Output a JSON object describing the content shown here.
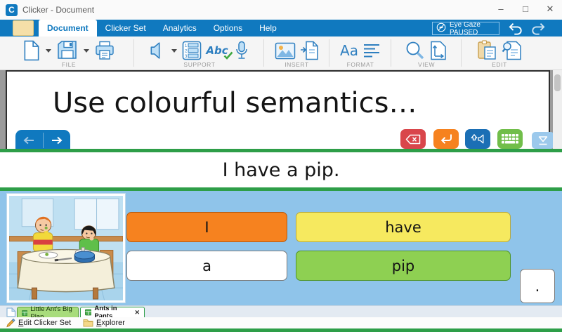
{
  "window": {
    "app_initial": "C",
    "title": "Clicker - Document",
    "controls": {
      "minimize": "–",
      "maximize": "□",
      "close": "✕"
    }
  },
  "colors": {
    "accent_blue": "#1079BF",
    "accent_green": "#2E9E48",
    "grid_background": "#8FC4EA"
  },
  "ribbon": {
    "tabs": [
      {
        "label": "Document",
        "active": true
      },
      {
        "label": "Clicker Set",
        "active": false
      },
      {
        "label": "Analytics",
        "active": false
      },
      {
        "label": "Options",
        "active": false
      },
      {
        "label": "Help",
        "active": false
      }
    ],
    "eye_gaze_label": "Eye Gaze PAUSED",
    "groups": [
      {
        "label": "FILE"
      },
      {
        "label": "SUPPORT"
      },
      {
        "label": "INSERT"
      },
      {
        "label": "FORMAT"
      },
      {
        "label": "VIEW"
      },
      {
        "label": "EDIT"
      }
    ],
    "spellcheck_glyph": "Abc",
    "font_glyph": "Aa"
  },
  "document": {
    "text": "Use colourful semantics…"
  },
  "sentence": {
    "text": "I have a pip."
  },
  "grid": {
    "cells": [
      {
        "label": "I",
        "fill": "#F6821F",
        "border": "#B35A10"
      },
      {
        "label": "have",
        "fill": "#F6E95F",
        "border": "#B8A93C"
      },
      {
        "label": "a",
        "fill": "#FFFFFF",
        "border": "#7A7A7A"
      },
      {
        "label": "pip",
        "fill": "#8ED052",
        "border": "#4F9427"
      },
      {
        "label": ".",
        "fill": "#FFFFFF",
        "border": "#7A7A7A"
      }
    ]
  },
  "set_tabs": [
    {
      "label": "Little Ant's Big Plan",
      "active": false
    },
    {
      "label": "Ants in Pants",
      "active": true,
      "close": "✕"
    }
  ],
  "status_bar": [
    {
      "label": "Edit Clicker Set"
    },
    {
      "label": "Explorer"
    }
  ]
}
